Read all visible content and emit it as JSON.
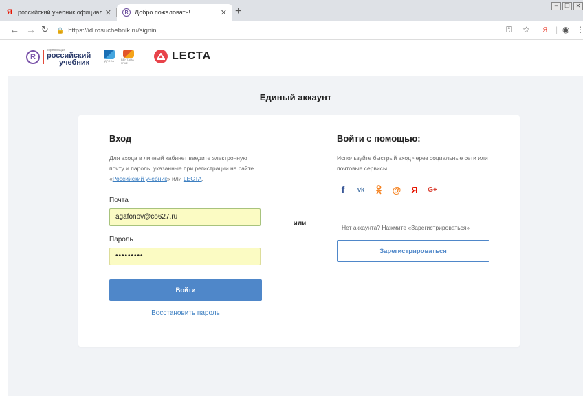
{
  "browser": {
    "tabs": [
      {
        "title": "российский учебник официаль",
        "favicon": "yandex-icon"
      },
      {
        "title": "Добро пожаловать!",
        "favicon": "rosuchebnik-icon"
      }
    ],
    "url": "https://id.rosuchebnik.ru/signin"
  },
  "header": {
    "logo_small": "корпорация",
    "logo_line1": "российский",
    "logo_line2": "учебник",
    "drofa_label": "ДРОФА",
    "ventana_label": "ВЕНТАНА ГРАФ",
    "lecta_label": "LECTA"
  },
  "page": {
    "heading": "Единый аккаунт"
  },
  "login": {
    "title": "Вход",
    "desc_part1": "Для входа в личный кабинет введите электронную почту и пароль, указанные при регистрации на сайте «",
    "desc_link1": "Российский учебник",
    "desc_part2": "» или ",
    "desc_link2": "LECTA",
    "desc_part3": ".",
    "email_label": "Почта",
    "email_value": "agafonov@co627.ru",
    "password_label": "Пароль",
    "password_value": "•••••••••",
    "submit_label": "Войти",
    "restore_label": "Восстановить пароль"
  },
  "divider": {
    "or_label": "или"
  },
  "social": {
    "title": "Войти с помощью:",
    "desc": "Используйте быстрый вход через социальные сети или почтовые сервисы",
    "icons": [
      {
        "name": "facebook-icon",
        "glyph": "f",
        "color": "#3b5998"
      },
      {
        "name": "vk-icon",
        "glyph": "vk",
        "color": "#4a76a8"
      },
      {
        "name": "odnoklassniki-icon",
        "glyph": "ok",
        "color": "#f58220"
      },
      {
        "name": "mailru-icon",
        "glyph": "@",
        "color": "#f58220"
      },
      {
        "name": "yandex-icon",
        "glyph": "Я",
        "color": "#e61400"
      },
      {
        "name": "google-plus-icon",
        "glyph": "G+",
        "color": "#db4437"
      }
    ],
    "no_account": "Нет аккаунта? Нажмите «Зарегистрироваться»",
    "register_label": "Зарегистрироваться"
  },
  "colors": {
    "primary": "#4f87c9",
    "background": "#f1f3f6",
    "autofill": "#fbfbc3",
    "lecta": "#e8434a"
  }
}
